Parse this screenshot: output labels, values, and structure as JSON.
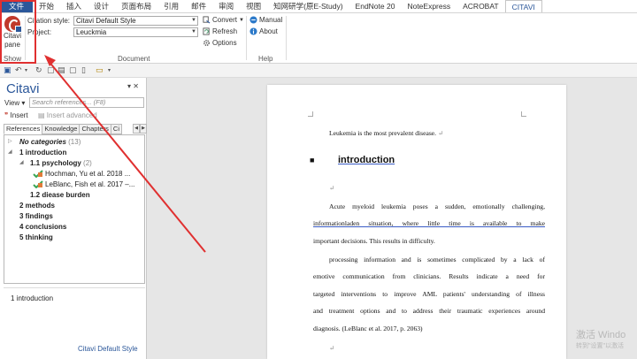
{
  "menu": {
    "items": [
      "文件",
      "开始",
      "插入",
      "设计",
      "页面布局",
      "引用",
      "邮件",
      "审阅",
      "视图",
      "知网研学(原E-Study)",
      "EndNote 20",
      "NoteExpress",
      "ACROBAT",
      "CITAVI"
    ],
    "active": "CITAVI"
  },
  "ribbon": {
    "citavi_pane": {
      "label1": "Citavi",
      "label2": "pane"
    },
    "show_group": "Show",
    "citation_style_label": "Citation style:",
    "citation_style_value": "Citavi Default Style",
    "project_label": "Project:",
    "project_value": "Leuckmia",
    "convert": "Convert",
    "refresh": "Refresh",
    "options": "Options",
    "document_group": "Document",
    "manual": "Manual",
    "about": "About",
    "help_group": "Help"
  },
  "pane": {
    "title": "Citavi",
    "view_label": "View",
    "search_placeholder": "Search references... (F8)",
    "insert": "Insert",
    "insert_advanced": "Insert advanced",
    "tabs": [
      "References",
      "Knowledge",
      "Chapters",
      "Ci"
    ],
    "tree": {
      "no_categories": "No categories",
      "no_categories_count": "(13)",
      "intro": "1 introduction",
      "psychology": "1.1 psychology",
      "psychology_count": "(2)",
      "ref1": "Hochman, Yu et al. 2018 ...",
      "ref2": "LeBlanc, Fish et al. 2017 –...",
      "disease": "1.2 diease burden",
      "methods": "2 methods",
      "findings": "3 findings",
      "conclusions": "4 conclusions",
      "thinking": "5 thinking"
    },
    "detail": "1 introduction",
    "footer": "Citavi Default Style"
  },
  "document": {
    "line1": "Leukemia is the most prevalent disease.",
    "heading": "introduction",
    "p1": [
      "Acute myeloid leukemia poses a sudden, emotionally challenging,",
      "informationladen situation, where little time is available to make",
      "important decisions. This results in difficulty."
    ],
    "p2": [
      "processing information and is sometimes complicated by a lack of",
      "emotive communication from clinicians. Results indicate a need for",
      "targeted interventions to improve AML patients' understanding of illness",
      "and treatment options and to address their traumatic experiences around",
      "diagnosis. (LeBlanc et al. 2017, p. 2063)"
    ]
  },
  "watermark": {
    "line1": "激活 Windo",
    "line2": "转到\"设置\"以激活"
  },
  "colors": {
    "accent": "#2b579a",
    "highlight": "#e03030"
  }
}
